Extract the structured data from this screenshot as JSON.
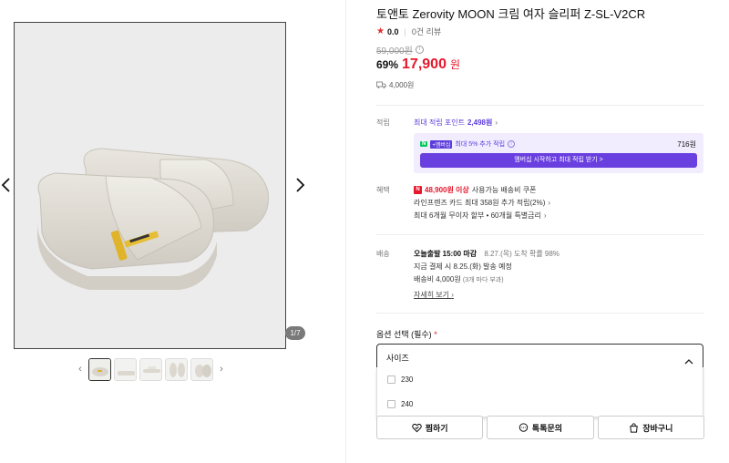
{
  "product": {
    "title": "토앤토 Zerovity MOON 크림 여자 슬리퍼 Z-SL-V2CR",
    "rating": "0.0",
    "reviews": "0건 리뷰",
    "original_price": "59,000원",
    "discount": "69%",
    "price": "17,900",
    "currency": "원",
    "shipping_fee": "4,000원"
  },
  "gallery": {
    "counter": "1/7",
    "image_count": 7,
    "current_index": 1
  },
  "points": {
    "label": "적립",
    "max_prefix": "최대 적립 포인트",
    "max_value": "2,498원",
    "membership_npay": "N",
    "membership_plus": "+멤버십",
    "membership_text": "최대 5% 추가 적립",
    "membership_amount": "716원",
    "membership_button": "멤버십 시작하고 최대 적립 받기 >"
  },
  "benefits": {
    "label": "혜택",
    "coupon_badge": "N",
    "coupon_amount": "48,900원 이상",
    "coupon_text": "사용가능 배송비 쿠폰",
    "card_text": "라인프렌즈 카드 최대 358원 추가 적립(2%)",
    "installment_text": "최대 6개월 무이자 할부 • 60개월 특별금리"
  },
  "delivery": {
    "label": "배송",
    "today": "오늘출발 15:00 마감",
    "arrival": "8.27.(목) 도착 확률 98%",
    "ship_date": "지금 결제 시 8.25.(화) 발송 예정",
    "fee_label": "배송비 4,000원",
    "fee_note": "(3개 마다 부과)",
    "detail_link": "자세히 보기"
  },
  "options": {
    "label": "옵션 선택 (필수)",
    "required_mark": "*",
    "select_label": "사이즈",
    "items": [
      {
        "label": "230"
      },
      {
        "label": "240"
      }
    ]
  },
  "actions": {
    "wish": "찜하기",
    "talk": "톡톡문의",
    "cart": "장바구니"
  },
  "colors": {
    "price_red": "#e5172b",
    "membership_purple": "#6a3fe0",
    "npay_green": "#03c75a"
  }
}
